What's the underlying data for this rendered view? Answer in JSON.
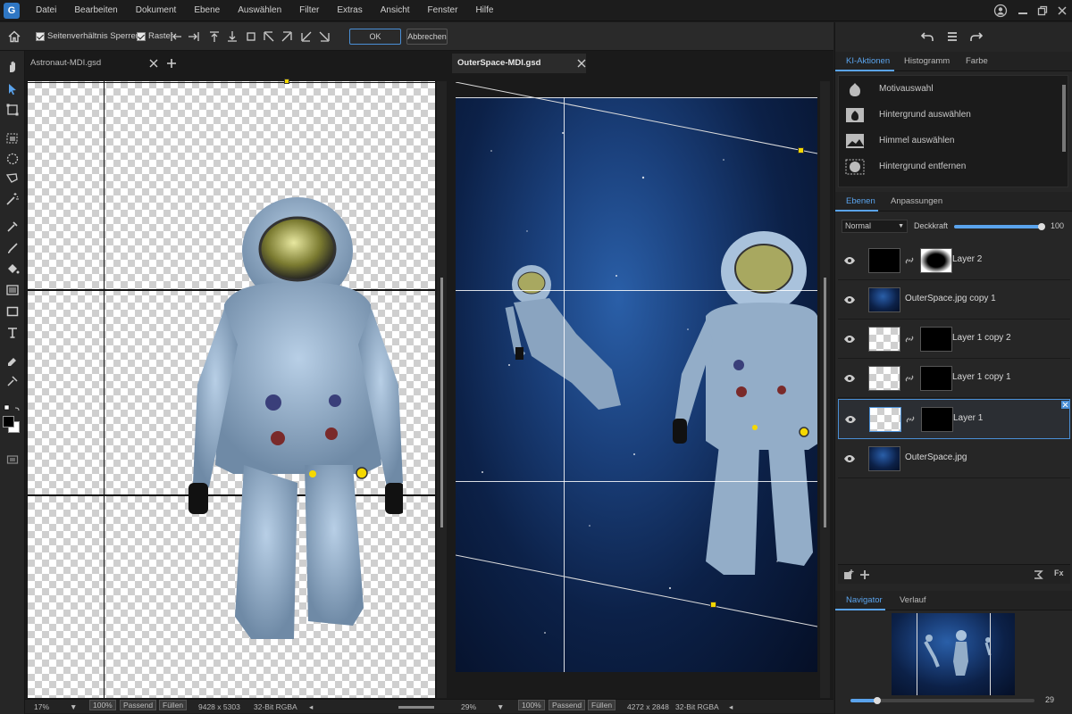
{
  "menu": [
    "Datei",
    "Bearbeiten",
    "Dokument",
    "Ebene",
    "Auswählen",
    "Filter",
    "Extras",
    "Ansicht",
    "Fenster",
    "Hilfe"
  ],
  "options": {
    "aspect_lock": "Seitenverhältnis Sperren",
    "grid": "Raster",
    "ok": "OK",
    "cancel": "Abbrechen"
  },
  "docs": [
    {
      "title": "Astronaut-MDI.gsd",
      "zoom": "17%",
      "ratio": "100%",
      "fit": "Passend",
      "fill": "Füllen",
      "size": "9428 x 5303",
      "mode": "32-Bit RGBA"
    },
    {
      "title": "OuterSpace-MDI.gsd",
      "zoom": "29%",
      "ratio": "100%",
      "fit": "Passend",
      "fill": "Füllen",
      "size": "4272 x 2848",
      "mode": "32-Bit RGBA"
    }
  ],
  "ki_panel": {
    "tabs": [
      "KI-Aktionen",
      "Histogramm",
      "Farbe"
    ],
    "items": [
      "Motivauswahl",
      "Hintergrund auswählen",
      "Himmel auswählen",
      "Hintergrund entfernen"
    ]
  },
  "layers_panel": {
    "tabs": [
      "Ebenen",
      "Anpassungen"
    ],
    "blend": "Normal",
    "opacity_label": "Deckkraft",
    "opacity_value": "100",
    "opacity": 1.0,
    "layers": [
      "Layer 2",
      "OuterSpace.jpg copy 1",
      "Layer 1 copy 2",
      "Layer 1 copy 1",
      "Layer 1",
      "OuterSpace.jpg"
    ]
  },
  "navigator": {
    "tabs": [
      "Navigator",
      "Verlauf"
    ],
    "zoom": "29"
  },
  "colors": {
    "accent": "#5aa3ec",
    "handle": "#f5d800"
  }
}
